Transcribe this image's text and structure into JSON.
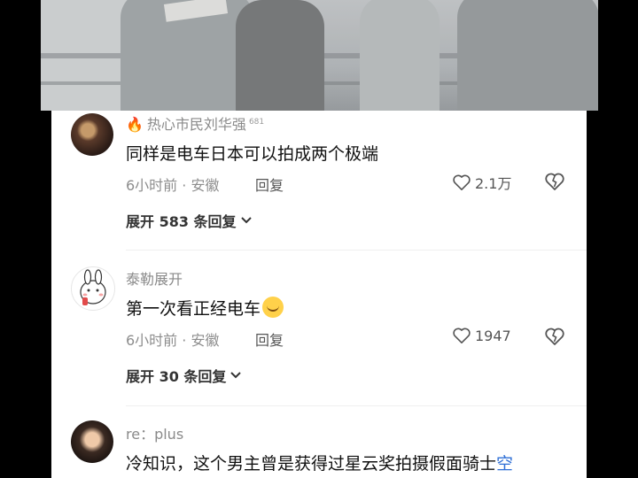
{
  "comments": [
    {
      "username": "热心市民刘华强",
      "badge": "681",
      "text": "同样是电车日本可以拍成两个极端",
      "time_location": "6小时前 · 安徽",
      "reply_label": "回复",
      "likes": "2.1万",
      "expand": "展开 583 条回复"
    },
    {
      "username": "泰勒展开",
      "text": "第一次看正经电车",
      "time_location": "6小时前 · 安徽",
      "reply_label": "回复",
      "likes": "1947",
      "expand": "展开 30 条回复"
    },
    {
      "username": "re：plus",
      "text": "冷知识，这个男主曾是获得过星云奖拍摄假面骑士",
      "text_tail": "空"
    }
  ],
  "icons": {
    "heart": "heart-icon",
    "broken_heart": "broken-heart-icon",
    "chevron": "chevron-down-icon",
    "fire": "fire-icon",
    "emoji": "smile-emoji-icon"
  },
  "colors": {
    "link_blue": "#2f6fd6",
    "fire": "#ff4d2a",
    "meta_gray": "#8d8d8d"
  }
}
